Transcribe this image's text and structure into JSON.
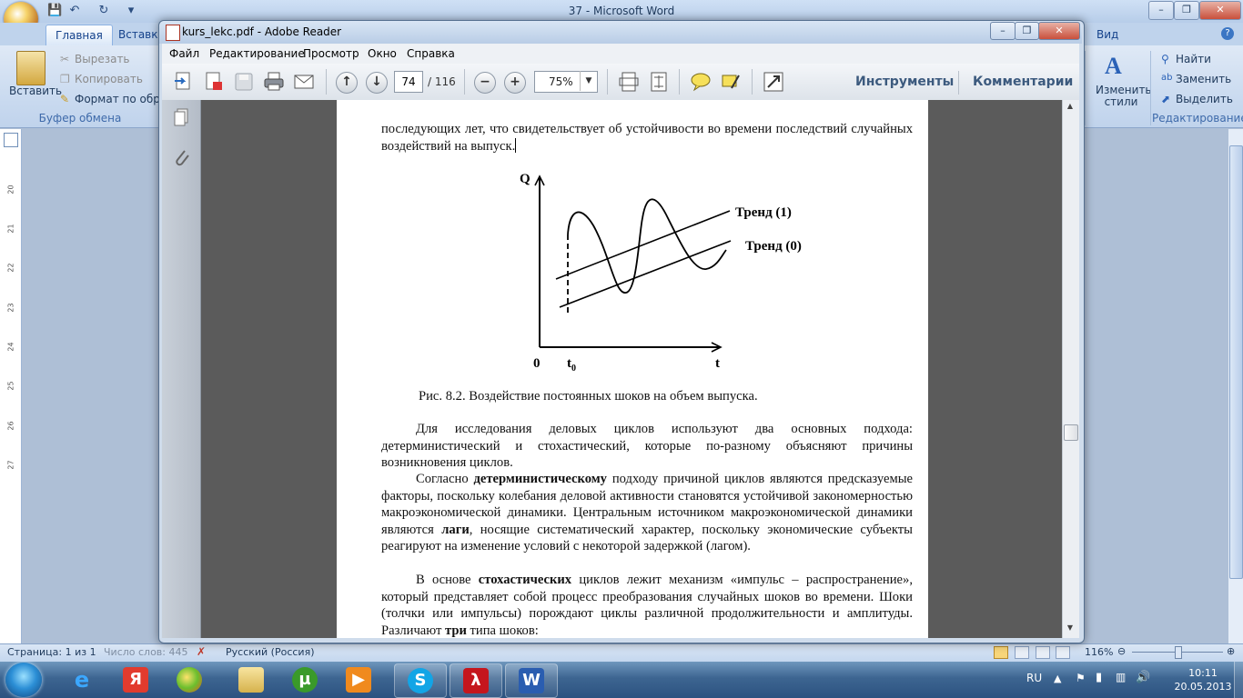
{
  "word": {
    "title": "37 - Microsoft Word",
    "tabs": [
      "Главная",
      "Вставка",
      "Вид"
    ],
    "clipboard": {
      "paste": "Вставить",
      "cut": "Вырезать",
      "copy": "Копировать",
      "format_painter": "Формат по образцу",
      "group": "Буфер обмена"
    },
    "styles": {
      "change": "Изменить стили"
    },
    "editing": {
      "find": "Найти",
      "replace": "Заменить",
      "select": "Выделить",
      "group": "Редактирование"
    },
    "status": {
      "page": "Страница: 1 из 1",
      "words": "Число слов: 445",
      "language": "Русский (Россия)",
      "zoom": "116%"
    },
    "ruler_numbers": [
      "20",
      "21",
      "22",
      "23",
      "24",
      "25",
      "26",
      "27"
    ]
  },
  "reader": {
    "title": "kurs_lekc.pdf - Adobe Reader",
    "menu": [
      "Файл",
      "Редактирование",
      "Просмотр",
      "Окно",
      "Справка"
    ],
    "page_current": "74",
    "page_total": "/ 116",
    "zoom": "75%",
    "tools": "Инструменты",
    "comments": "Комментарии"
  },
  "document": {
    "intro": "последующих лет, что свидетельствует об устойчивости во времени последствий случайных воздействий на выпуск.",
    "figure": {
      "y_label": "Q",
      "x_label": "t",
      "origin": "0",
      "t0": "t",
      "t0_sub": "0",
      "trend1": "Тренд (1)",
      "trend0": "Тренд (0)"
    },
    "caption": "Рис. 8.2. Воздействие постоянных шоков на объем выпуска.",
    "p1": "Для  исследования деловых циклов используют два основных подхода: детерминистический и стохастический, которые по-разному объясняют причины возникновения циклов.",
    "p2_pre": "Согласно",
    "p2_bold": "детерминистическому",
    "p2_mid": "подходу причиной циклов являются предсказуемые факторы, поскольку колебания деловой активности становятся устойчивой закономерностью макроэкономической динамики. Центральным источником макроэкономической динамики являются",
    "p2_bold2": "лаги",
    "p2_post": ", носящие систематический характер, поскольку экономические субъекты реагируют на изменение условий с некоторой задержкой (лагом).",
    "p3_pre": "В основе",
    "p3_bold": "стохастических",
    "p3_post": "циклов лежит механизм «импульс – распространение», который представляет собой процесс преобразования случайных шоков  во времени. Шоки (толчки или импульсы) порождают циклы различной продолжительности и амплитуды. Различают",
    "p3_bold2": "три",
    "p3_end": "типа шоков:"
  },
  "taskbar": {
    "lang": "RU",
    "time": "10:11",
    "date": "20.05.2013"
  }
}
